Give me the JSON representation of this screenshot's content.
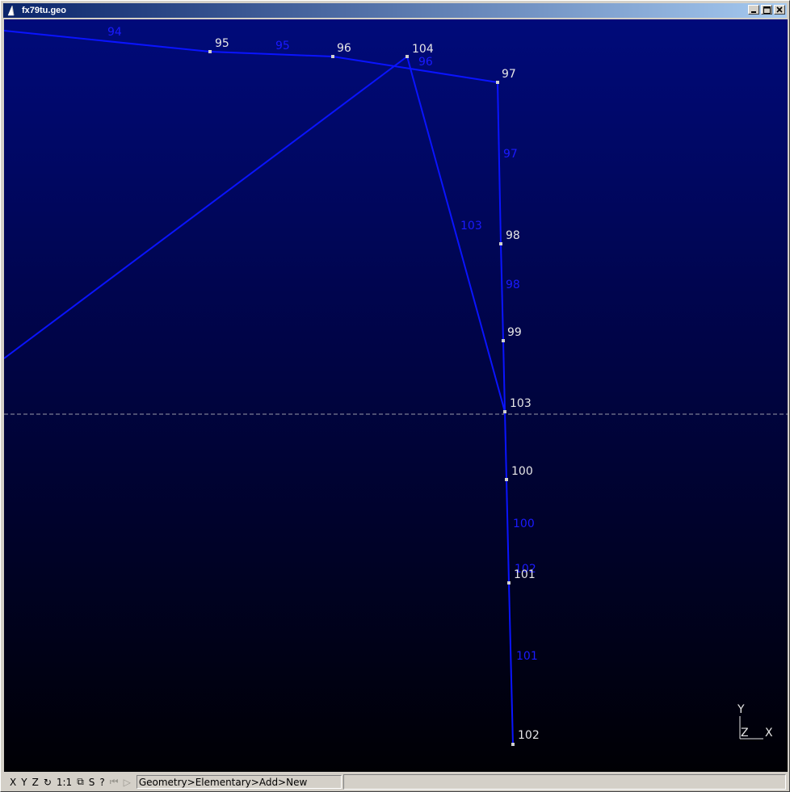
{
  "window": {
    "title": "fx79tu.geo"
  },
  "colors": {
    "lines": "#0a14ff",
    "point_labels": "#e6e6e6",
    "line_labels": "#1a1aff",
    "points": "#cfcfcf"
  },
  "points": [
    {
      "id": "p95",
      "label": "95"
    },
    {
      "id": "p96",
      "label": "96"
    },
    {
      "id": "p104",
      "label": "104"
    },
    {
      "id": "p97",
      "label": "97"
    },
    {
      "id": "p98",
      "label": "98"
    },
    {
      "id": "p99",
      "label": "99"
    },
    {
      "id": "p103",
      "label": "103"
    },
    {
      "id": "p100",
      "label": "100"
    },
    {
      "id": "p101",
      "label": "101"
    },
    {
      "id": "p102",
      "label": "102"
    }
  ],
  "lines": [
    {
      "id": "l94",
      "label": "94"
    },
    {
      "id": "l95",
      "label": "95"
    },
    {
      "id": "l96",
      "label": "96"
    },
    {
      "id": "l97",
      "label": "97"
    },
    {
      "id": "l103",
      "label": "103"
    },
    {
      "id": "l98",
      "label": "98"
    },
    {
      "id": "l100",
      "label": "100"
    },
    {
      "id": "l101",
      "label": "101"
    },
    {
      "id": "l102",
      "label": "102"
    }
  ],
  "axes": {
    "y": "Y",
    "z": "Z",
    "x": "X"
  },
  "statusbar": {
    "x": "X",
    "y": "Y",
    "z": "Z",
    "rotate": "↻",
    "one_to_one": "1:1",
    "ortho": "⧉",
    "s": "S",
    "help": "?",
    "first": "⏮",
    "play": "▷",
    "message": "Geometry>Elementary>Add>New",
    "message2": ""
  }
}
